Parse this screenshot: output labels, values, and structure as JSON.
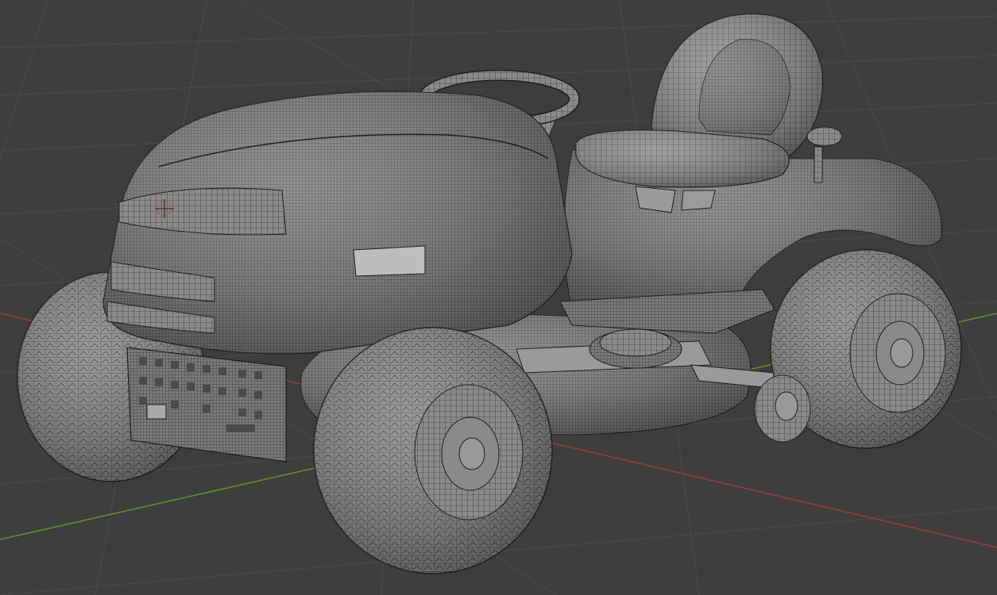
{
  "app": {
    "name": "",
    "mode": "Edit Mode"
  },
  "viewport": {
    "background_color": "#3d3d3d",
    "grid_color": "#4a4a4a",
    "x_axis_color": "#9b3a44",
    "y_axis_color": "#6a8f2e",
    "mesh_fill_color": "#8a8a8a",
    "mesh_wire_color": "#1e1e1e",
    "wheel_fill_color": "#7c7c7c",
    "cursor_color": "#d04545",
    "object": "riding-lawn-mower-mesh",
    "display": "wireframe-overlay",
    "icons": {
      "cursor": "3d-cursor-icon"
    }
  }
}
